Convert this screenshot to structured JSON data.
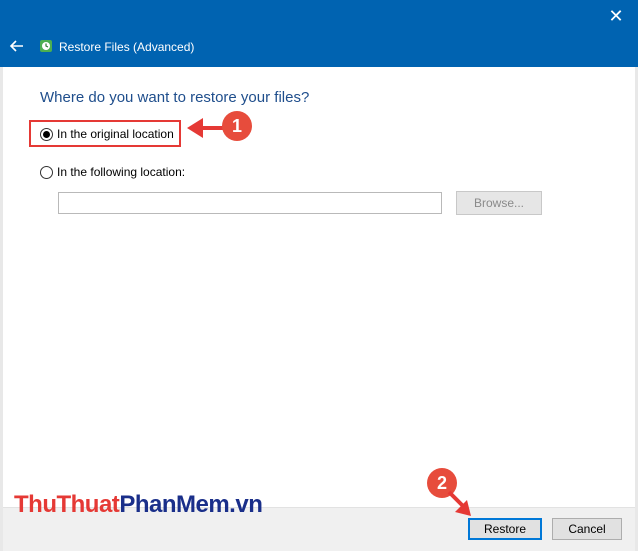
{
  "window": {
    "title": "Restore Files (Advanced)",
    "close_glyph": "✕"
  },
  "main": {
    "question": "Where do you want to restore your files?",
    "options": [
      {
        "label": "In the original location",
        "selected": true
      },
      {
        "label": "In the following location:",
        "selected": false
      }
    ],
    "path_value": "",
    "browse_label": "Browse..."
  },
  "footer": {
    "restore_label": "Restore",
    "cancel_label": "Cancel"
  },
  "annotations": {
    "step1": "1",
    "step2": "2"
  },
  "watermark": {
    "part1": "ThuThuat",
    "part2": "PhanMem",
    "part3": ".vn"
  },
  "colors": {
    "titlebar": "#0063b1",
    "annotation": "#e53935",
    "question_text": "#1f4e8c"
  }
}
